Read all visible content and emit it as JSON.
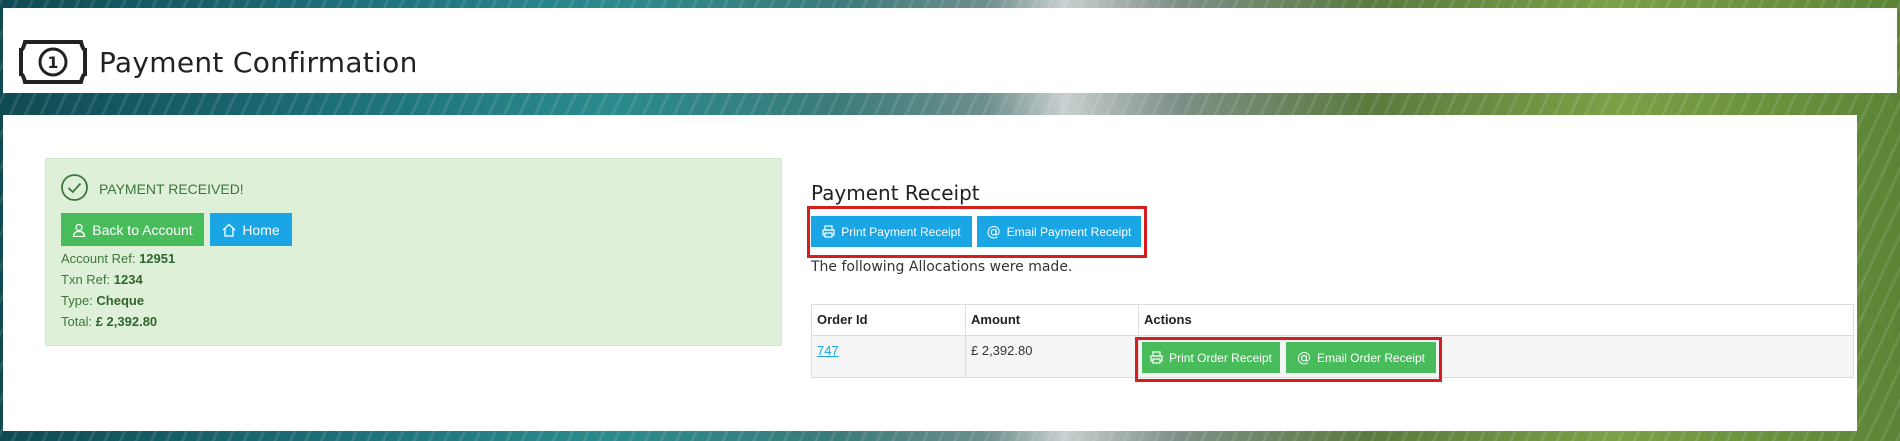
{
  "header": {
    "title": "Payment Confirmation",
    "icon": "money-bill-icon"
  },
  "status": {
    "message": "PAYMENT RECEIVED!",
    "icon": "check-circle-icon",
    "color": "#3c763d",
    "panel_color": "#dff0d8"
  },
  "nav_buttons": {
    "back": {
      "label": "Back to Account",
      "icon": "user-icon",
      "color": "#48bb5b"
    },
    "home": {
      "label": "Home",
      "icon": "home-icon",
      "color": "#1aa6e4"
    }
  },
  "details": {
    "account_ref_label": "Account Ref:",
    "account_ref_value": "12951",
    "txn_ref_label": "Txn Ref:",
    "txn_ref_value": "1234",
    "type_label": "Type:",
    "type_value": "Cheque",
    "total_label": "Total:",
    "total_value": "£ 2,392.80"
  },
  "receipt": {
    "title": "Payment Receipt",
    "print_label": "Print Payment Receipt",
    "email_label": "Email Payment Receipt",
    "allocations_text": "The following Allocations were made."
  },
  "table": {
    "headers": [
      "Order Id",
      "Amount",
      "Actions"
    ],
    "rows": [
      {
        "order_id": "747",
        "amount": "£ 2,392.80",
        "print_label": "Print Order Receipt",
        "email_label": "Email Order Receipt"
      }
    ]
  },
  "colors": {
    "highlight": "#d41f1f",
    "green": "#48bb5b",
    "blue": "#1aa6e4"
  }
}
